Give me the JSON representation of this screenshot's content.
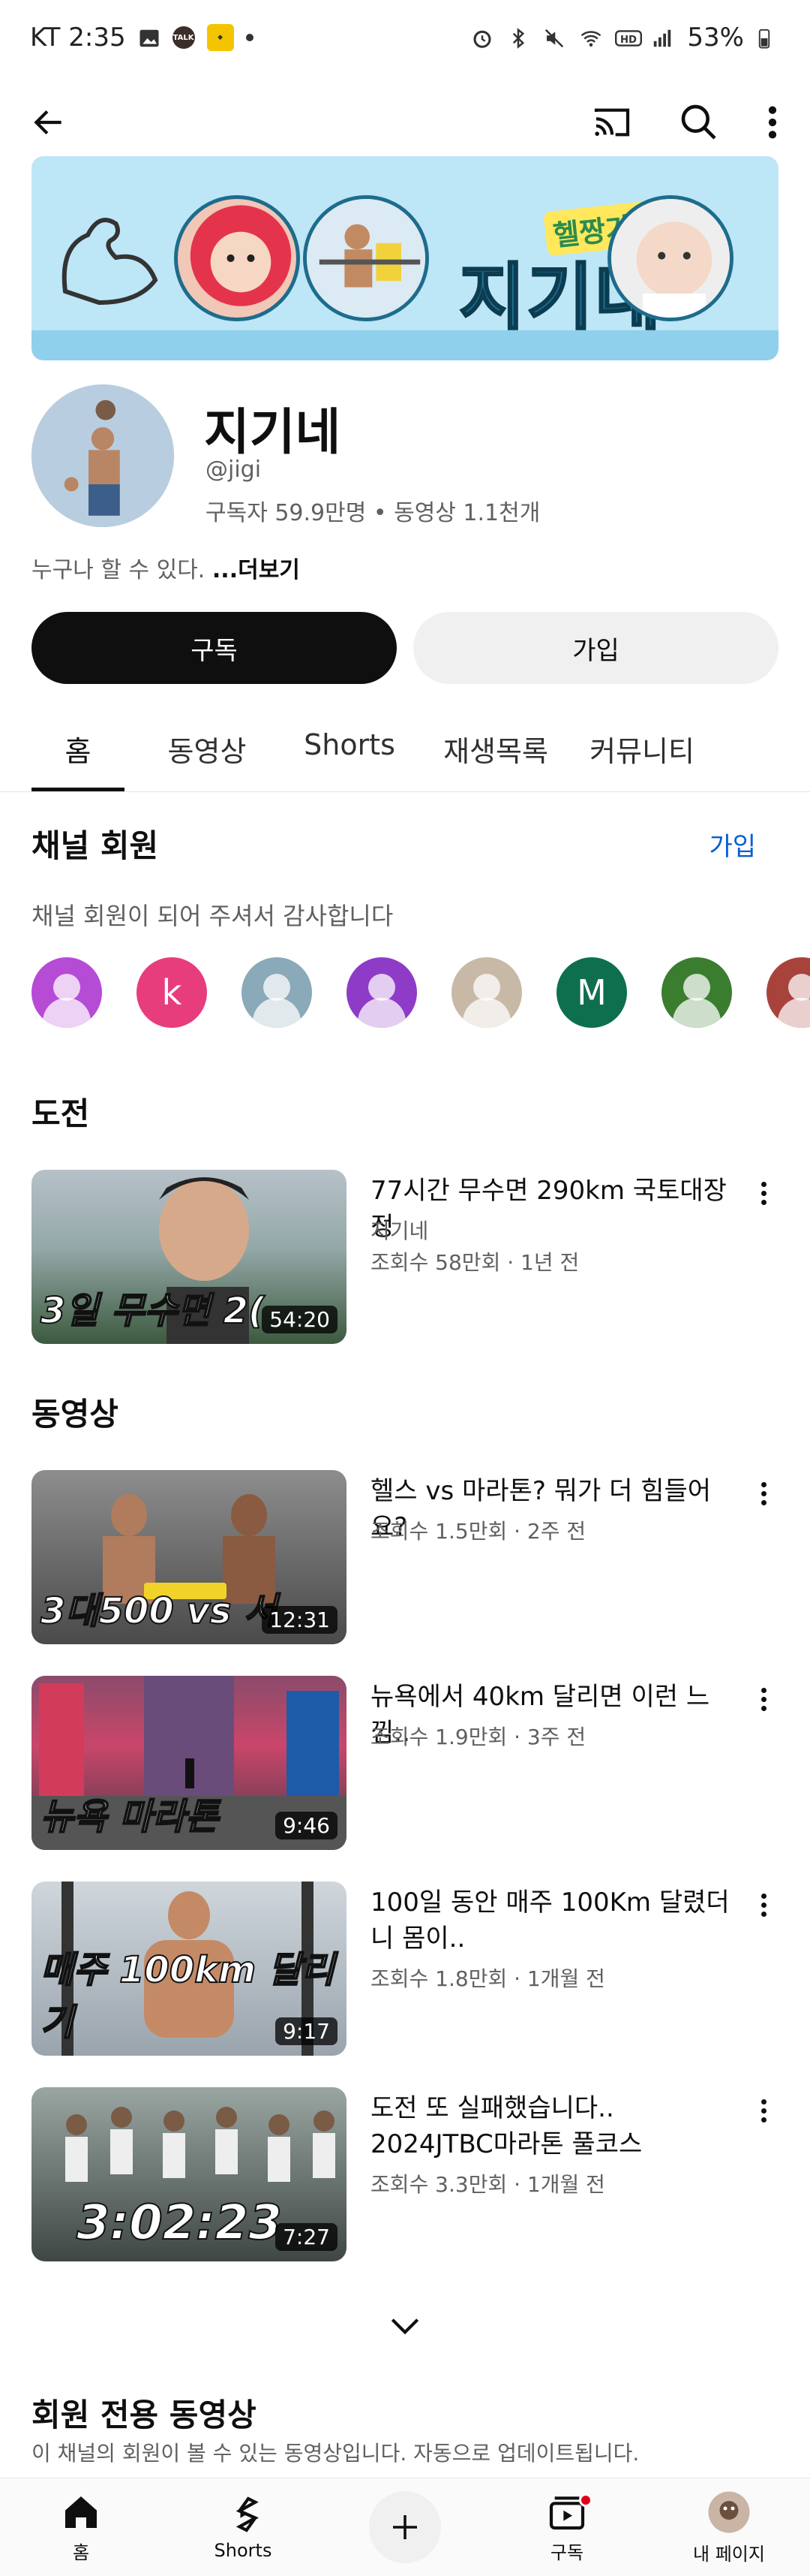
{
  "status_bar": {
    "carrier_time": "KT 2:35",
    "talk_badge": "TALK",
    "battery": "53%"
  },
  "channel": {
    "banner_title": "지기네",
    "banner_subtitle": "헬짱가족",
    "name": "지기네",
    "handle": "@jigi",
    "stats": "구독자 59.9만명 • 동영상 1.1천개",
    "description": "누구나 할 수 있다.",
    "more": "...더보기",
    "subscribe_label": "구독",
    "join_label": "가입"
  },
  "tabs": [
    "홈",
    "동영상",
    "Shorts",
    "재생목록",
    "커뮤니티"
  ],
  "members_section": {
    "title": "채널 회원",
    "join_link": "가입",
    "subtitle": "채널 회원이 되어 주셔서 감사합니다",
    "avatars": [
      {
        "letter": "",
        "color": "#b64bd6"
      },
      {
        "letter": "k",
        "color": "#e83d7d"
      },
      {
        "letter": "",
        "color": "#8aa9b9"
      },
      {
        "letter": "",
        "color": "#8e3cc7"
      },
      {
        "letter": "",
        "color": "#c7b9a6"
      },
      {
        "letter": "M",
        "color": "#0e6f4e"
      },
      {
        "letter": "",
        "color": "#3a7d2f"
      },
      {
        "letter": "",
        "color": "#a8433c"
      }
    ]
  },
  "challenge": {
    "title": "도전",
    "video": {
      "title": "77시간 무수면 290km 국토대장정",
      "channel": "지기네",
      "meta": "조회수 58만회 · 1년 전",
      "overlay": "3일 무수면 2(",
      "duration": "54:20"
    }
  },
  "videos": {
    "title": "동영상",
    "items": [
      {
        "title": "헬스 vs 마라톤? 뭐가 더 힘들어요?",
        "meta": "조회수 1.5만회 · 2주 전",
        "overlay": "3대500 vs 서",
        "duration": "12:31"
      },
      {
        "title": "뉴욕에서 40km 달리면 이런 느낌..",
        "meta": "조회수 1.9만회 · 3주 전",
        "overlay": "뉴욕 마라톤",
        "duration": "9:46"
      },
      {
        "title": "100일 동안 매주 100Km 달렸더니 몸이..",
        "meta": "조회수 1.8만회 · 1개월 전",
        "overlay": "매주 100km 달리기",
        "duration": "9:17"
      },
      {
        "title": "도전 또 실패했습니다.. 2024JTBC마라톤 풀코스",
        "meta": "조회수 3.3만회 · 1개월 전",
        "overlay": "3:02:23",
        "duration": "7:27"
      }
    ]
  },
  "members_videos": {
    "title": "회원 전용 동영상",
    "subtitle": "이 채널의 회원이 볼 수 있는 동영상입니다. 자동으로 업데이트됩니다."
  },
  "bottom_nav": {
    "home": "홈",
    "shorts": "Shorts",
    "subscriptions": "구독",
    "me": "내 페이지"
  }
}
